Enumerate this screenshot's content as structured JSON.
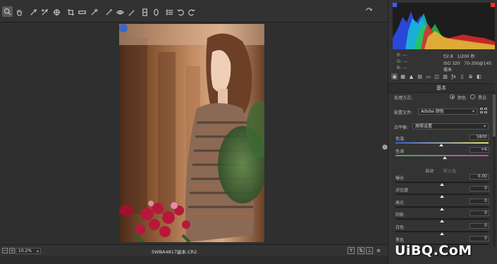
{
  "toolbar": {
    "tools": [
      "zoom-tool-icon",
      "hand-tool-icon",
      "white-balance-tool-icon",
      "color-sampler-tool-icon",
      "targeted-adjustment-tool-icon",
      "crop-tool-icon",
      "straighten-tool-icon",
      "spot-removal-tool-icon",
      "red-eye-removal-tool-icon",
      "adjustment-brush-icon",
      "graduated-filter-icon",
      "radial-filter-icon",
      "preferences-list-icon",
      "rotate-left-icon",
      "rotate-right-icon"
    ],
    "right_icon": "fullscreen-toggle-icon"
  },
  "statusbar": {
    "zoom": "10.2%",
    "filename": "SWBA4817副本.CR2",
    "before_after_label": "Y"
  },
  "histogram": {
    "rgb_labels": [
      "R:",
      "G:",
      "B:"
    ],
    "rgb_values": [
      "---",
      "---",
      "---"
    ],
    "aperture": "f/2.8",
    "shutter": "1/200 秒",
    "iso": "ISO 320",
    "lens": "70-200@145 毫米"
  },
  "panel": {
    "section_title": "基本",
    "treatment_label": "处理方式:",
    "treatment_color": "颜色",
    "treatment_bw": "黑白",
    "profile_label": "配置文件:",
    "profile_value": "Adobe 颜色",
    "wb_label": "白平衡:",
    "wb_value": "原照设置",
    "auto_label": "自动",
    "default_label": "默认值",
    "sliders": [
      {
        "label": "色温",
        "value": "5800",
        "position": 0.49
      },
      {
        "label": "色调",
        "value": "+6",
        "position": 0.53
      },
      {
        "label": "曝光",
        "value": "0.00",
        "position": 0.5
      },
      {
        "label": "对比度",
        "value": "0",
        "position": 0.5
      },
      {
        "label": "高光",
        "value": "0",
        "position": 0.5
      },
      {
        "label": "阴影",
        "value": "0",
        "position": 0.5
      },
      {
        "label": "白色",
        "value": "0",
        "position": 0.5
      },
      {
        "label": "黑色",
        "value": "0",
        "position": 0.5
      }
    ]
  },
  "watermark": "UiBQ.CoM"
}
